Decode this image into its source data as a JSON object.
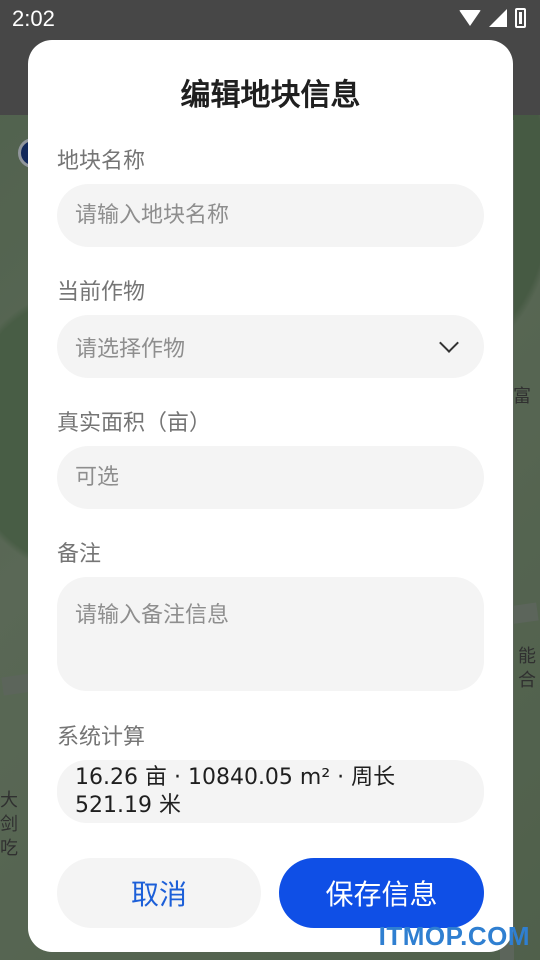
{
  "status_bar": {
    "time": "2:02"
  },
  "dialog": {
    "title": "编辑地块信息",
    "plot_name": {
      "label": "地块名称",
      "placeholder": "请输入地块名称"
    },
    "crop": {
      "label": "当前作物",
      "placeholder": "请选择作物"
    },
    "area": {
      "label": "真实面积（亩）",
      "placeholder": "可选"
    },
    "remark": {
      "label": "备注",
      "placeholder": "请输入备注信息"
    },
    "system_calc": {
      "label": "系统计算",
      "value": "16.26 亩 · 10840.05 m² · 周长521.19 米"
    },
    "buttons": {
      "cancel": "取消",
      "save": "保存信息"
    }
  },
  "background_map": {
    "labels": [
      "富",
      "能",
      "合",
      "大",
      "剑",
      "吃"
    ]
  },
  "watermark": "ITMOP.COM",
  "colors": {
    "primary": "#0f4fe6",
    "accent_text": "#1c5fd8",
    "field_bg": "#f4f4f4"
  }
}
